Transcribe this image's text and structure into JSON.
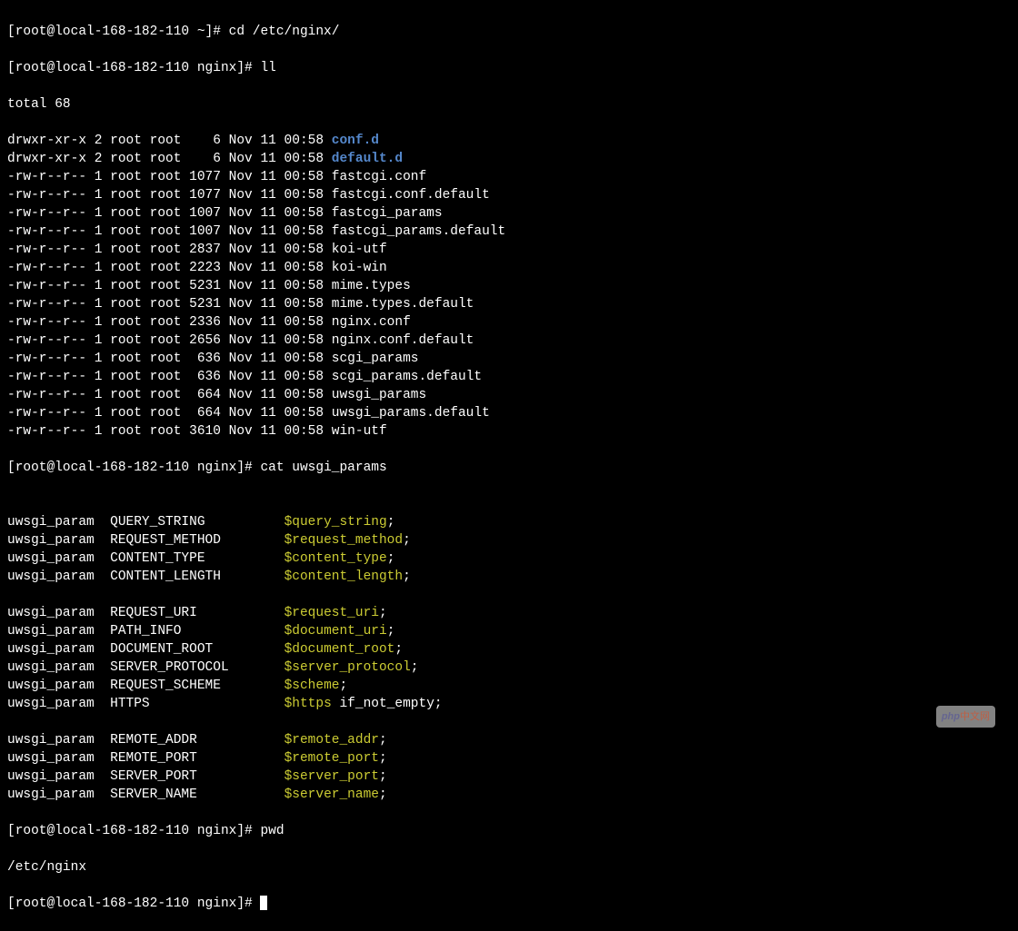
{
  "prompts": {
    "p1_host": "[root@local-168-182-110 ~]# ",
    "p1_cmd": "cd /etc/nginx/",
    "p2_host": "[root@local-168-182-110 nginx]# ",
    "p2_cmd": "ll",
    "p3_host": "[root@local-168-182-110 nginx]# ",
    "p3_cmd": "cat uwsgi_params",
    "p4_host": "[root@local-168-182-110 nginx]# ",
    "p4_cmd": "pwd",
    "p4_out": "/etc/nginx",
    "p5_host": "[root@local-168-182-110 nginx]# "
  },
  "ll": {
    "total": "total 68",
    "rows": [
      {
        "perm": "drwxr-xr-x",
        "links": "2",
        "owner": "root",
        "group": "root",
        "size": "6",
        "month": "Nov",
        "day": "11",
        "time": "00:58",
        "name": "conf.d",
        "isdir": true
      },
      {
        "perm": "drwxr-xr-x",
        "links": "2",
        "owner": "root",
        "group": "root",
        "size": "6",
        "month": "Nov",
        "day": "11",
        "time": "00:58",
        "name": "default.d",
        "isdir": true
      },
      {
        "perm": "-rw-r--r--",
        "links": "1",
        "owner": "root",
        "group": "root",
        "size": "1077",
        "month": "Nov",
        "day": "11",
        "time": "00:58",
        "name": "fastcgi.conf",
        "isdir": false
      },
      {
        "perm": "-rw-r--r--",
        "links": "1",
        "owner": "root",
        "group": "root",
        "size": "1077",
        "month": "Nov",
        "day": "11",
        "time": "00:58",
        "name": "fastcgi.conf.default",
        "isdir": false
      },
      {
        "perm": "-rw-r--r--",
        "links": "1",
        "owner": "root",
        "group": "root",
        "size": "1007",
        "month": "Nov",
        "day": "11",
        "time": "00:58",
        "name": "fastcgi_params",
        "isdir": false
      },
      {
        "perm": "-rw-r--r--",
        "links": "1",
        "owner": "root",
        "group": "root",
        "size": "1007",
        "month": "Nov",
        "day": "11",
        "time": "00:58",
        "name": "fastcgi_params.default",
        "isdir": false
      },
      {
        "perm": "-rw-r--r--",
        "links": "1",
        "owner": "root",
        "group": "root",
        "size": "2837",
        "month": "Nov",
        "day": "11",
        "time": "00:58",
        "name": "koi-utf",
        "isdir": false
      },
      {
        "perm": "-rw-r--r--",
        "links": "1",
        "owner": "root",
        "group": "root",
        "size": "2223",
        "month": "Nov",
        "day": "11",
        "time": "00:58",
        "name": "koi-win",
        "isdir": false
      },
      {
        "perm": "-rw-r--r--",
        "links": "1",
        "owner": "root",
        "group": "root",
        "size": "5231",
        "month": "Nov",
        "day": "11",
        "time": "00:58",
        "name": "mime.types",
        "isdir": false
      },
      {
        "perm": "-rw-r--r--",
        "links": "1",
        "owner": "root",
        "group": "root",
        "size": "5231",
        "month": "Nov",
        "day": "11",
        "time": "00:58",
        "name": "mime.types.default",
        "isdir": false
      },
      {
        "perm": "-rw-r--r--",
        "links": "1",
        "owner": "root",
        "group": "root",
        "size": "2336",
        "month": "Nov",
        "day": "11",
        "time": "00:58",
        "name": "nginx.conf",
        "isdir": false
      },
      {
        "perm": "-rw-r--r--",
        "links": "1",
        "owner": "root",
        "group": "root",
        "size": "2656",
        "month": "Nov",
        "day": "11",
        "time": "00:58",
        "name": "nginx.conf.default",
        "isdir": false
      },
      {
        "perm": "-rw-r--r--",
        "links": "1",
        "owner": "root",
        "group": "root",
        "size": "636",
        "month": "Nov",
        "day": "11",
        "time": "00:58",
        "name": "scgi_params",
        "isdir": false
      },
      {
        "perm": "-rw-r--r--",
        "links": "1",
        "owner": "root",
        "group": "root",
        "size": "636",
        "month": "Nov",
        "day": "11",
        "time": "00:58",
        "name": "scgi_params.default",
        "isdir": false
      },
      {
        "perm": "-rw-r--r--",
        "links": "1",
        "owner": "root",
        "group": "root",
        "size": "664",
        "month": "Nov",
        "day": "11",
        "time": "00:58",
        "name": "uwsgi_params",
        "isdir": false
      },
      {
        "perm": "-rw-r--r--",
        "links": "1",
        "owner": "root",
        "group": "root",
        "size": "664",
        "month": "Nov",
        "day": "11",
        "time": "00:58",
        "name": "uwsgi_params.default",
        "isdir": false
      },
      {
        "perm": "-rw-r--r--",
        "links": "1",
        "owner": "root",
        "group": "root",
        "size": "3610",
        "month": "Nov",
        "day": "11",
        "time": "00:58",
        "name": "win-utf",
        "isdir": false
      }
    ]
  },
  "uwsgi": {
    "groups": [
      [
        {
          "key": "QUERY_STRING",
          "var": "$query_string",
          "suffix": ";"
        },
        {
          "key": "REQUEST_METHOD",
          "var": "$request_method",
          "suffix": ";"
        },
        {
          "key": "CONTENT_TYPE",
          "var": "$content_type",
          "suffix": ";"
        },
        {
          "key": "CONTENT_LENGTH",
          "var": "$content_length",
          "suffix": ";"
        }
      ],
      [
        {
          "key": "REQUEST_URI",
          "var": "$request_uri",
          "suffix": ";"
        },
        {
          "key": "PATH_INFO",
          "var": "$document_uri",
          "suffix": ";"
        },
        {
          "key": "DOCUMENT_ROOT",
          "var": "$document_root",
          "suffix": ";"
        },
        {
          "key": "SERVER_PROTOCOL",
          "var": "$server_protocol",
          "suffix": ";"
        },
        {
          "key": "REQUEST_SCHEME",
          "var": "$scheme",
          "suffix": ";"
        },
        {
          "key": "HTTPS",
          "var": "$https",
          "suffix": " if_not_empty;"
        }
      ],
      [
        {
          "key": "REMOTE_ADDR",
          "var": "$remote_addr",
          "suffix": ";"
        },
        {
          "key": "REMOTE_PORT",
          "var": "$remote_port",
          "suffix": ";"
        },
        {
          "key": "SERVER_PORT",
          "var": "$server_port",
          "suffix": ";"
        },
        {
          "key": "SERVER_NAME",
          "var": "$server_name",
          "suffix": ";"
        }
      ]
    ],
    "directive": "uwsgi_param"
  },
  "watermark": {
    "php": "php",
    "cn": "中文网"
  }
}
